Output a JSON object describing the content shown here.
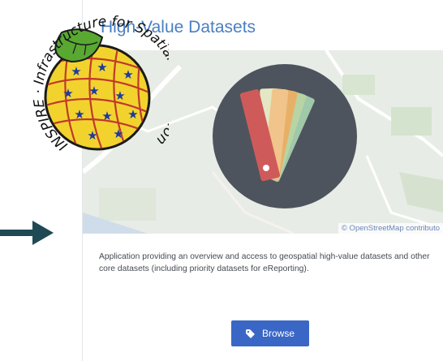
{
  "card": {
    "title": "High-Value Datasets",
    "map_attribution": "© OpenStreetMap contributo",
    "description": "Application providing an overview and access to geospatial high-value datasets and other core datasets (including priority datasets for eReporting).",
    "browse_label": "Browse"
  },
  "logo": {
    "ring_text": "INSPIRE · Infrastructure for Spatial Information in Europe"
  },
  "colors": {
    "title": "#4a7fc1",
    "button": "#3a66c6",
    "arrow": "#1f4a55",
    "logo_globe": "#f2d32e",
    "logo_leaf": "#58a832"
  },
  "icons": {
    "button_icon": "tag-icon",
    "card_icon": "color-palette-fan-icon",
    "arrow_icon": "arrow-right-icon"
  }
}
